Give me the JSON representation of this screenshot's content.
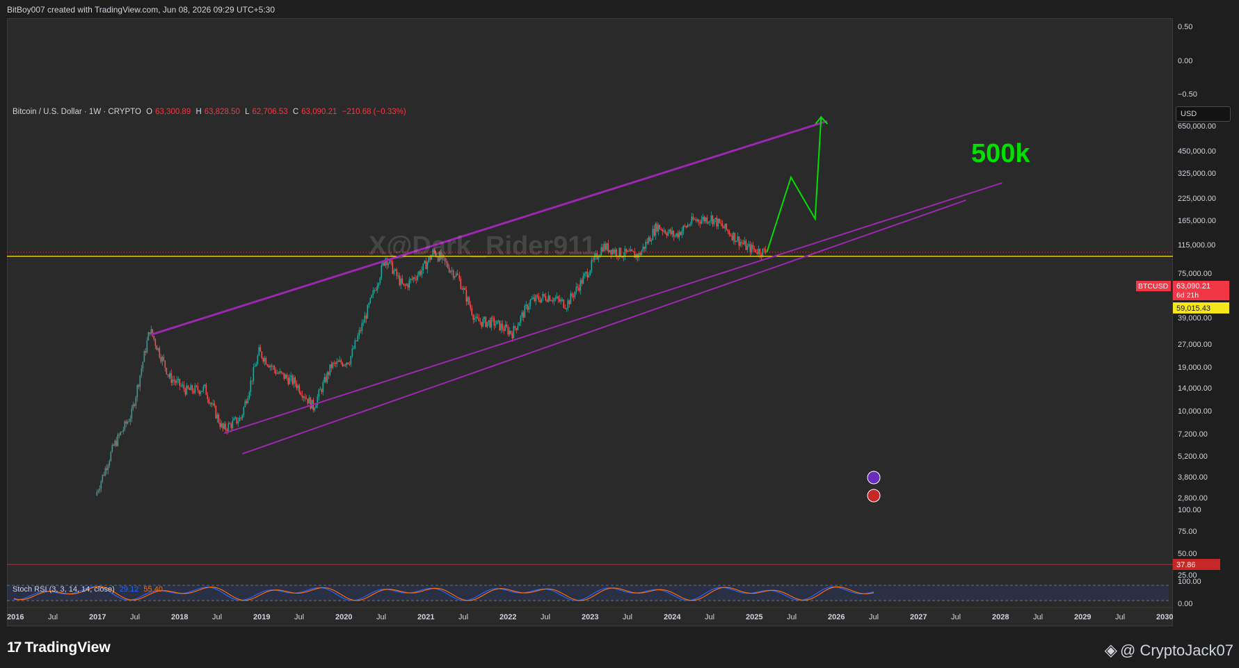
{
  "header": {
    "created_text": "BitBoy007 created with TradingView.com, Jun 08, 2026 09:29 UTC+5:30"
  },
  "symbol": {
    "title": "Bitcoin / U.S. Dollar · 1W · CRYPTO",
    "o_label": "O",
    "o_value": "63,300.89",
    "h_label": "H",
    "h_value": "63,828.50",
    "l_label": "L",
    "l_value": "62,706.53",
    "c_label": "C",
    "c_value": "63,090.21",
    "change": "−210.68 (−0.33%)"
  },
  "currency_label": "USD",
  "watermark_text": "X@Dark_Rider911",
  "target_text": "500k",
  "price_axis": {
    "ticks": [
      "0.50",
      "0.00",
      "−0.50",
      "650,000.00",
      "450,000.00",
      "325,000.00",
      "225,000.00",
      "165,000.00",
      "115,000.00",
      "75,000.00",
      "39,000.00",
      "27,000.00",
      "19,000.00",
      "14,000.00",
      "10,000.00",
      "7,200.00",
      "5,200.00",
      "3,800.00",
      "2,800.00",
      "100.00",
      "75.00",
      "50.00",
      "25.00",
      "100.00",
      "0.00"
    ],
    "symbol_tag": "BTCUSD",
    "last_price": "63,090.21",
    "countdown": "6d 21h",
    "level_price": "59,015.43",
    "rsi_tag": "37.86"
  },
  "time_axis": [
    "2016",
    "Jul",
    "2017",
    "Jul",
    "2018",
    "Jul",
    "2019",
    "Jul",
    "2020",
    "Jul",
    "2021",
    "Jul",
    "2022",
    "Jul",
    "2023",
    "Jul",
    "2024",
    "Jul",
    "2025",
    "Jul",
    "2026",
    "Jul",
    "2027",
    "Jul",
    "2028",
    "Jul",
    "2029",
    "Jul",
    "2030"
  ],
  "indicator": {
    "label": "Stoch RSI (3, 3, 14, 14, close)",
    "k_value": "29.12",
    "d_value": "55.40"
  },
  "footer": {
    "logo_text": "TradingView",
    "credit_text": "@ CryptoJack07"
  },
  "chart_data": {
    "type": "candlestick",
    "title": "Bitcoin / U.S. Dollar · 1W · CRYPTO",
    "y_scale": "log",
    "time_range": [
      "2016",
      "2030"
    ],
    "price_series": {
      "name": "BTCUSD",
      "x": [
        "2017-03",
        "2017-06",
        "2017-09",
        "2017-12",
        "2018-03",
        "2018-06",
        "2018-09",
        "2018-12",
        "2019-03",
        "2019-06",
        "2019-09",
        "2019-12",
        "2020-03",
        "2020-06",
        "2020-09",
        "2020-12",
        "2021-03",
        "2021-06",
        "2021-09",
        "2021-11",
        "2022-03",
        "2022-06",
        "2022-09",
        "2022-12",
        "2023-03",
        "2023-06",
        "2023-09",
        "2023-12",
        "2024-03",
        "2024-06",
        "2024-09",
        "2024-12",
        "2025-03",
        "2025-06",
        "2025-09",
        "2025-12",
        "2026-03",
        "2026-06"
      ],
      "y": [
        1100,
        2500,
        4300,
        17500,
        8000,
        6300,
        6500,
        3300,
        4000,
        12000,
        8500,
        7200,
        4800,
        9500,
        10500,
        24000,
        58000,
        35000,
        47000,
        64000,
        42000,
        20000,
        19500,
        16500,
        28000,
        30500,
        26500,
        42000,
        70000,
        62000,
        60000,
        98000,
        83000,
        107000,
        112000,
        88000,
        68000,
        63090
      ]
    },
    "horizontal_level": 59015.43,
    "upper_channel": {
      "x": [
        "2017-12",
        "2027-04"
      ],
      "y": [
        16000,
        560000
      ]
    },
    "lower_channel_1": {
      "x": [
        "2018-12",
        "2029-09"
      ],
      "y": [
        3100,
        200000
      ]
    },
    "lower_channel_2": {
      "x": [
        "2019-03",
        "2029-03"
      ],
      "y": [
        2200,
        150000
      ]
    },
    "projection": {
      "x": [
        "2026-06",
        "2026-10",
        "2027-02",
        "2027-03"
      ],
      "y": [
        63090,
        220000,
        110000,
        600000
      ]
    },
    "stoch_rsi": {
      "k": 29.12,
      "d": 55.4,
      "range": [
        0,
        100
      ]
    },
    "colors": {
      "channel": "#9c27b0",
      "projection": "#00e000",
      "level": "#f5e51b",
      "up": "#26a69a",
      "down": "#ef5350"
    }
  }
}
